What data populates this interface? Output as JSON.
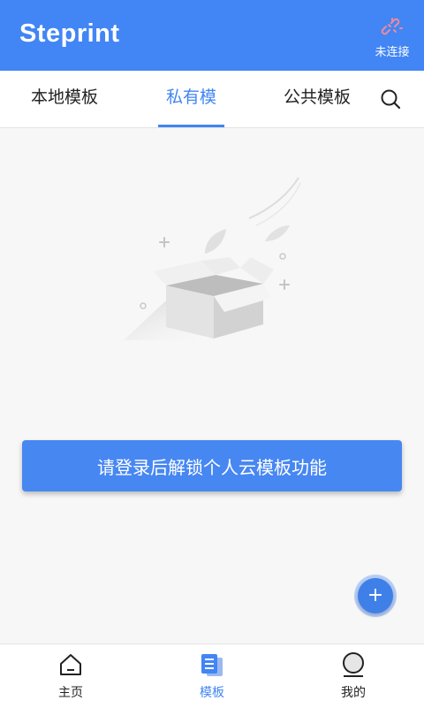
{
  "header": {
    "logo": "Steprint",
    "connection_status": "未连接",
    "icons": {
      "connection": "unlinked-chain-icon"
    }
  },
  "tabs": [
    {
      "label": "本地模板",
      "active": false
    },
    {
      "label": "私有模板",
      "active": true
    },
    {
      "label": "公共模板",
      "active": false
    }
  ],
  "search": {
    "icon": "search-icon"
  },
  "main": {
    "illustration": "empty-box-illustration",
    "login_button": "请登录后解锁个人云模板功能"
  },
  "fab": {
    "label": "+",
    "icon": "plus-icon"
  },
  "bottom_nav": [
    {
      "label": "主页",
      "icon": "home-icon",
      "active": false
    },
    {
      "label": "模板",
      "icon": "template-icon",
      "active": true
    },
    {
      "label": "我的",
      "icon": "profile-icon",
      "active": false
    }
  ],
  "colors": {
    "accent": "#4285f4",
    "background": "#f7f7f7"
  }
}
